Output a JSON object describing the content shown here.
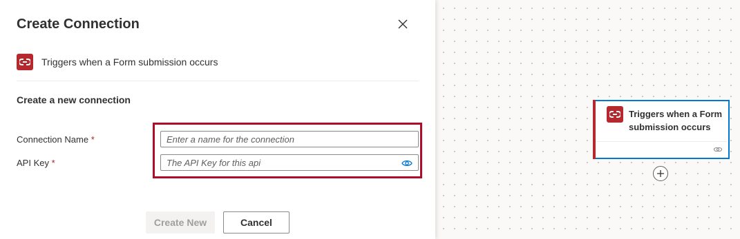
{
  "panel": {
    "title": "Create Connection",
    "trigger_label": "Triggers when a Form submission occurs",
    "section_title": "Create a new connection",
    "fields": {
      "connection_name": {
        "label": "Connection Name",
        "required_mark": "*",
        "value": "",
        "placeholder": "Enter a name for the connection"
      },
      "api_key": {
        "label": "API Key",
        "required_mark": "*",
        "value": "",
        "placeholder": "The API Key for this api"
      }
    },
    "buttons": {
      "create_label": "Create New",
      "cancel_label": "Cancel"
    }
  },
  "canvas": {
    "card": {
      "title": "Triggers when a Form submission occurs"
    }
  },
  "colors": {
    "brand": "#b4282e",
    "highlight": "#b00d2a",
    "accent": "#0078d4"
  },
  "icons": {
    "close": "close-icon",
    "connector_logo": "connector-logo-icon",
    "show_password": "eye-icon",
    "link": "link-icon",
    "add": "plus-icon"
  }
}
